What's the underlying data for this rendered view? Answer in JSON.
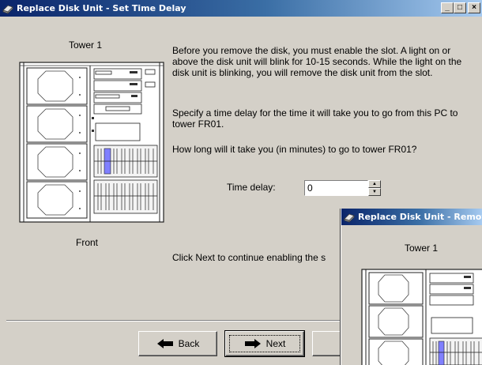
{
  "main_window": {
    "title": "Replace Disk Unit - Set Time Delay",
    "minimize": "_",
    "maximize": "□",
    "close": "×",
    "tower_label": "Tower 1",
    "front_label": "Front",
    "paragraph1": "Before you remove the disk, you must enable the slot.  A light on or above the disk unit will blink for 10-15 seconds.  While the light on the disk unit is blinking, you will remove the disk unit from the slot.",
    "paragraph2": "Specify a time delay for the time it will take you to go from this PC to tower FR01.",
    "question": "How long will it take you (in minutes) to go to tower FR01?",
    "time_delay_label": "Time delay:",
    "time_delay_value": "0",
    "continue_text": "Click Next to continue enabling the s",
    "buttons": {
      "back": "Back",
      "next": "Next"
    },
    "icons": {
      "title": "disk-unit-icon",
      "back": "arrow-left-icon",
      "next": "arrow-right-icon",
      "finish": "checkmark-icon"
    }
  },
  "second_window": {
    "title": "Replace Disk Unit - Remov",
    "tower_label": "Tower 1"
  },
  "colors": {
    "dialog_bg": "#d4d0c8",
    "title_start": "#0a246a",
    "title_end": "#a6caf0",
    "highlight": "#8080ff"
  }
}
